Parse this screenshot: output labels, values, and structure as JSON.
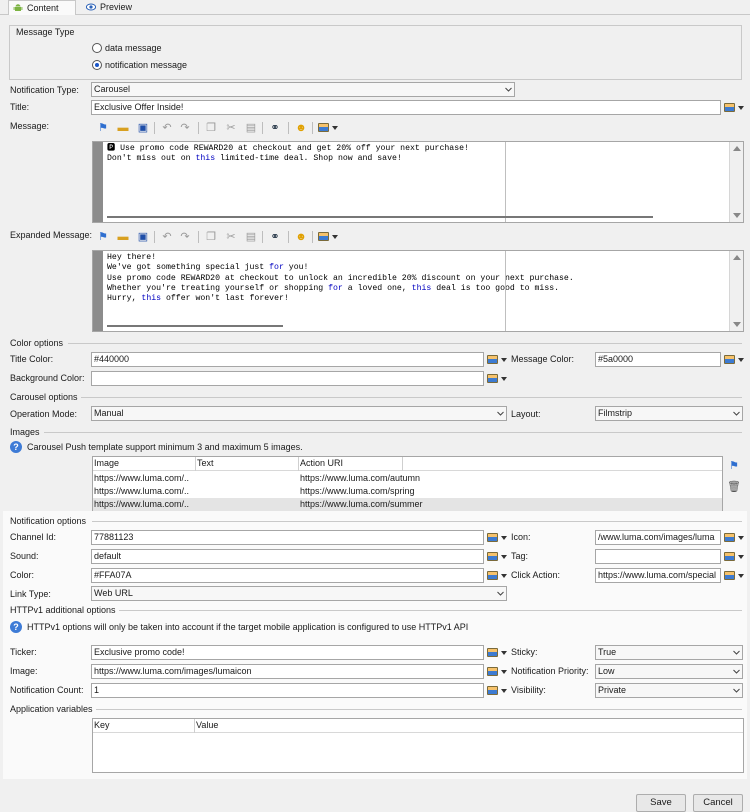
{
  "tabs": [
    {
      "label": "Content",
      "icon": "android-icon"
    },
    {
      "label": "Preview",
      "icon": "eye-icon"
    }
  ],
  "message_type": {
    "group_title": "Message Type",
    "options": [
      {
        "label": "data message",
        "selected": false
      },
      {
        "label": "notification message",
        "selected": true
      }
    ]
  },
  "notification_type": {
    "label": "Notification Type:",
    "value": "Carousel"
  },
  "title": {
    "label": "Title:",
    "value": "Exclusive Offer Inside!"
  },
  "message": {
    "label": "Message:",
    "lines": [
      "🅿 Use promo code REWARD20 at checkout and get 20% off your next purchase!",
      "Don't miss out on this limited-time deal. Shop now and save!"
    ]
  },
  "expanded_message": {
    "label": "Expanded Message:",
    "lines": [
      "Hey there!",
      "We've got something special just for you!",
      "Use promo code REWARD20 at checkout to unlock an incredible 20% discount on your next purchase.",
      "Whether you're treating yourself or shopping for a loved one, this deal is too good to miss.",
      "Hurry, this offer won't last forever!"
    ]
  },
  "color_options": {
    "group_title": "Color options",
    "title_color_label": "Title Color:",
    "title_color": "#440000",
    "message_color_label": "Message Color:",
    "message_color": "#5a0000",
    "background_color_label": "Background Color:",
    "background_color": ""
  },
  "carousel_options": {
    "group_title": "Carousel options",
    "operation_mode_label": "Operation Mode:",
    "operation_mode": "Manual",
    "layout_label": "Layout:",
    "layout": "Filmstrip"
  },
  "images": {
    "group_title": "Images",
    "info_text": "Carousel Push template support minimum 3 and maximum 5 images.",
    "columns": [
      "Image",
      "Text",
      "Action URI"
    ],
    "rows": [
      [
        "https://www.luma.com/..",
        "",
        "https://www.luma.com/autumn"
      ],
      [
        "https://www.luma.com/..",
        "",
        "https://www.luma.com/spring"
      ],
      [
        "https://www.luma.com/..",
        "",
        "https://www.luma.com/summer"
      ]
    ]
  },
  "notification_options": {
    "group_title": "Notification options",
    "channel_id_label": "Channel Id:",
    "channel_id": "77881123",
    "sound_label": "Sound:",
    "sound": "default",
    "color_label": "Color:",
    "color": "#FFA07A",
    "link_type_label": "Link Type:",
    "link_type": "Web URL",
    "icon_label": "Icon:",
    "icon": "/www.luma.com/images/luma",
    "tag_label": "Tag:",
    "tag": "",
    "click_action_label": "Click Action:",
    "click_action": "https://www.luma.com/special"
  },
  "httpv1": {
    "group_title": "HTTPv1 additional options",
    "info_text": "HTTPv1 options will only be taken into account if the target mobile application is configured to use HTTPv1 API",
    "ticker_label": "Ticker:",
    "ticker": "Exclusive promo code!",
    "image_label": "Image:",
    "image": "https://www.luma.com/images/lumaicon",
    "notification_count_label": "Notification Count:",
    "notification_count": "1",
    "sticky_label": "Sticky:",
    "sticky": "True",
    "priority_label": "Notification Priority:",
    "priority": "Low",
    "visibility_label": "Visibility:",
    "visibility": "Private"
  },
  "application_variables": {
    "group_title": "Application variables",
    "columns": [
      "Key",
      "Value"
    ]
  },
  "buttons": {
    "save": "Save",
    "cancel": "Cancel"
  }
}
